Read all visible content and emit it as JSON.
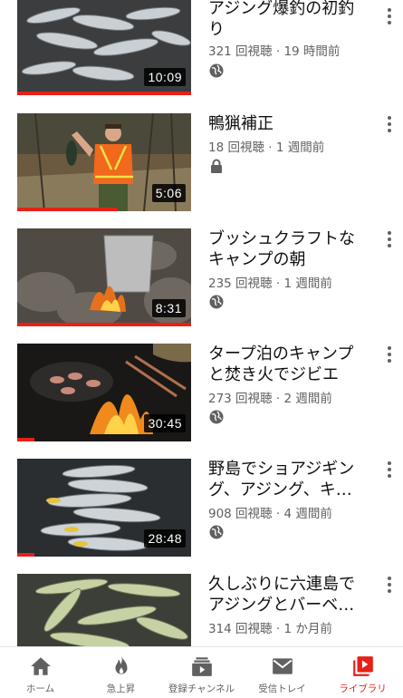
{
  "videos": [
    {
      "title": "アジング爆釣の初釣り",
      "views": "321 回視聴",
      "age": "19 時間前",
      "duration": "10:09",
      "privacy": "globe-icon",
      "progress": 1.0
    },
    {
      "title": "鴨猟補正",
      "views": "18 回視聴",
      "age": "1 週間前",
      "duration": "5:06",
      "privacy": "lock-icon",
      "progress": 0.58
    },
    {
      "title": "ブッシュクラフトなキャンプの朝",
      "views": "235 回視聴",
      "age": "1 週間前",
      "duration": "8:31",
      "privacy": "globe-icon",
      "progress": 1.0
    },
    {
      "title": "タープ泊のキャンプと焚き火でジビエ",
      "views": "273 回視聴",
      "age": "2 週間前",
      "duration": "30:45",
      "privacy": "globe-icon",
      "progress": 0.1
    },
    {
      "title": "野島でショアジギング、アジング、キ…",
      "views": "908 回視聴",
      "age": "4 週間前",
      "duration": "28:48",
      "privacy": "globe-icon",
      "progress": 0.1
    },
    {
      "title": "久しぶりに六連島でアジングとバーベ…",
      "views": "314 回視聴",
      "age": "1 か月前",
      "duration": "",
      "privacy": "",
      "progress": 0
    }
  ],
  "separator": " · ",
  "nav": {
    "home": "ホーム",
    "trending": "急上昇",
    "subscriptions": "登録チャンネル",
    "inbox": "受信トレイ",
    "library": "ライブラリ"
  },
  "colors": {
    "accent": "#e62117",
    "text": "#0f0f0f",
    "secondary": "#606060"
  }
}
